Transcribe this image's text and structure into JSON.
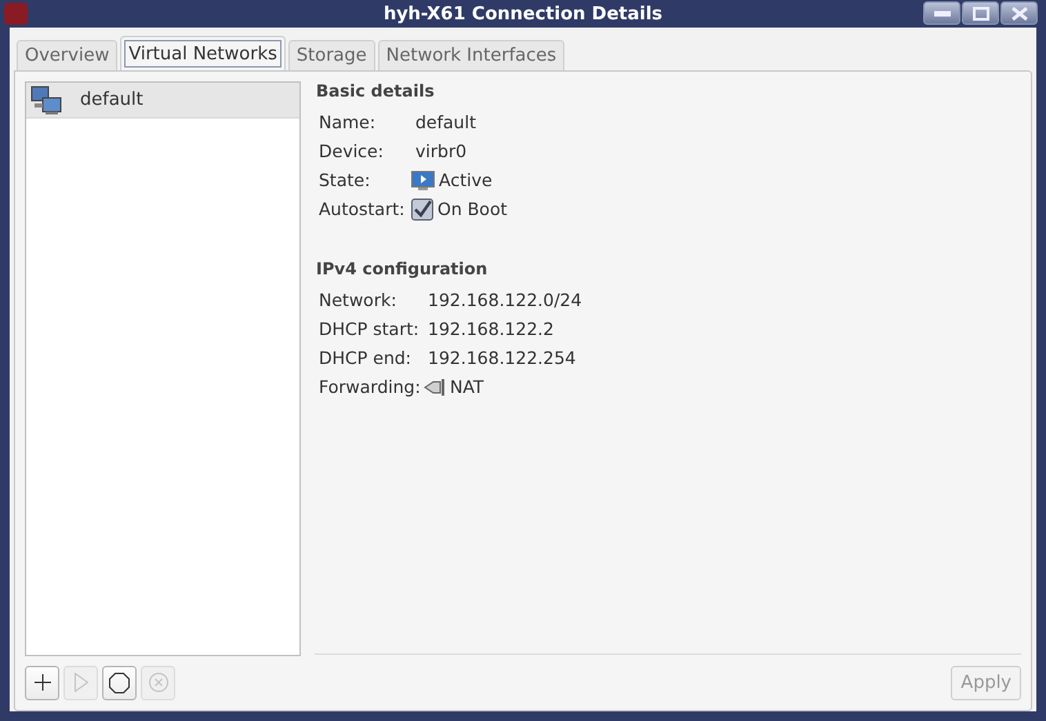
{
  "window": {
    "title": "hyh-X61 Connection Details"
  },
  "tabs": [
    {
      "label": "Overview",
      "selected": false
    },
    {
      "label": "Virtual Networks",
      "selected": true
    },
    {
      "label": "Storage",
      "selected": false
    },
    {
      "label": "Network Interfaces",
      "selected": false
    }
  ],
  "networks": [
    {
      "name": "default",
      "selected": true
    }
  ],
  "sections": [
    {
      "title": "Basic details",
      "rows": [
        {
          "label": "Name:",
          "value": "default",
          "kind": "text"
        },
        {
          "label": "Device:",
          "value": "virbr0",
          "kind": "text"
        },
        {
          "label": "State:",
          "value": "Active",
          "kind": "status"
        },
        {
          "label": "Autostart:",
          "value": "On Boot",
          "kind": "checkbox",
          "checked": true
        }
      ]
    },
    {
      "title": "IPv4 configuration",
      "rows": [
        {
          "label": "Network:",
          "value": "192.168.122.0/24",
          "kind": "text"
        },
        {
          "label": "DHCP start:",
          "value": "192.168.122.2",
          "kind": "text"
        },
        {
          "label": "DHCP end:",
          "value": "192.168.122.254",
          "kind": "text"
        },
        {
          "label": "Forwarding:",
          "value": "NAT",
          "kind": "forward"
        }
      ]
    }
  ],
  "tools": [
    {
      "kind": "add",
      "disabled": false
    },
    {
      "kind": "start",
      "disabled": true
    },
    {
      "kind": "stop",
      "disabled": false
    },
    {
      "kind": "delete",
      "disabled": true
    }
  ],
  "apply": {
    "label": "Apply",
    "disabled": true
  }
}
